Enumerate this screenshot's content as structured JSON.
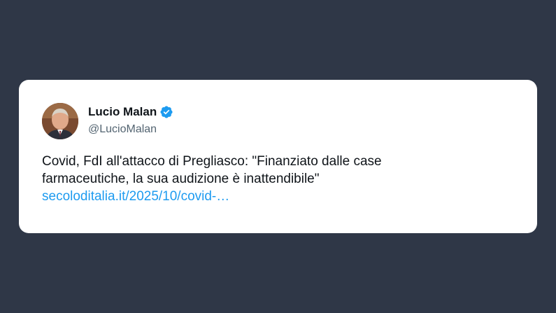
{
  "tweet": {
    "author": {
      "name": "Lucio Malan",
      "handle": "@LucioMalan",
      "verified": true,
      "avatar_icon": "profile-photo-icon"
    },
    "text_lines": [
      "Covid, FdI all'attacco di Pregliasco: \"Finanziato dalle case",
      "farmaceutiche, la sua audizione è inattendibile\""
    ],
    "link_text": "secoloditalia.it/2025/10/covid-…"
  },
  "colors": {
    "background": "#2f3747",
    "card": "#ffffff",
    "text": "#0f1419",
    "secondary": "#536471",
    "link": "#1d9bf0",
    "verified_badge": "#1d9bf0"
  }
}
